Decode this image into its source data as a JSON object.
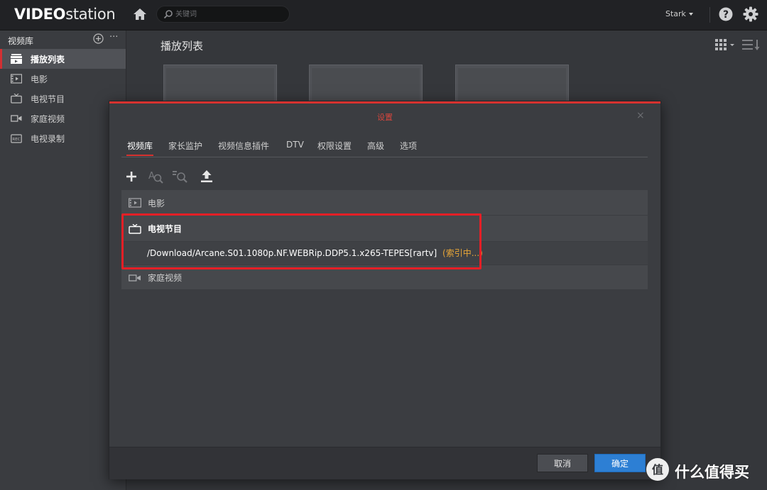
{
  "app": {
    "logo_bold": "VIDEO",
    "logo_light": "station"
  },
  "topbar": {
    "search_placeholder": "关键词",
    "user_name": "Stark"
  },
  "sidebar": {
    "header": "视频库",
    "add_icon": "plus-circle-icon",
    "more_label": "···",
    "items": [
      {
        "label": "播放列表",
        "icon": "playlist-icon",
        "active": true
      },
      {
        "label": "电影",
        "icon": "film-icon",
        "active": false
      },
      {
        "label": "电视节目",
        "icon": "tv-icon",
        "active": false
      },
      {
        "label": "家庭视频",
        "icon": "camcorder-icon",
        "active": false
      },
      {
        "label": "电视录制",
        "icon": "rec-icon",
        "active": false
      }
    ]
  },
  "content": {
    "title": "播放列表"
  },
  "dialog": {
    "title": "设置",
    "close_label": "×",
    "tabs": [
      {
        "label": "视频库",
        "active": true
      },
      {
        "label": "家长监护",
        "active": false
      },
      {
        "label": "视频信息插件",
        "active": false
      },
      {
        "label": "DTV",
        "active": false
      },
      {
        "label": "权限设置",
        "active": false
      },
      {
        "label": "高级",
        "active": false
      },
      {
        "label": "选项",
        "active": false
      }
    ],
    "toolbar": [
      "add-icon",
      "search-text-icon",
      "search-magnify-icon",
      "upload-icon"
    ],
    "libraries": {
      "movies": "电影",
      "tv": "电视节目",
      "tv_path": "/Download/Arcane.S01.1080p.NF.WEBRip.DDP5.1.x265-TEPES[rartv]",
      "tv_status": "(索引中...)",
      "home": "家庭视频"
    },
    "cancel_label": "取消",
    "ok_label": "确定"
  },
  "watermark": {
    "text": "什么值得买",
    "glyph": "值"
  },
  "colors": {
    "accent_red": "#d6322f",
    "highlight_red": "#e51f26",
    "primary_blue": "#2d7fd4",
    "status_orange": "#e8a638"
  }
}
